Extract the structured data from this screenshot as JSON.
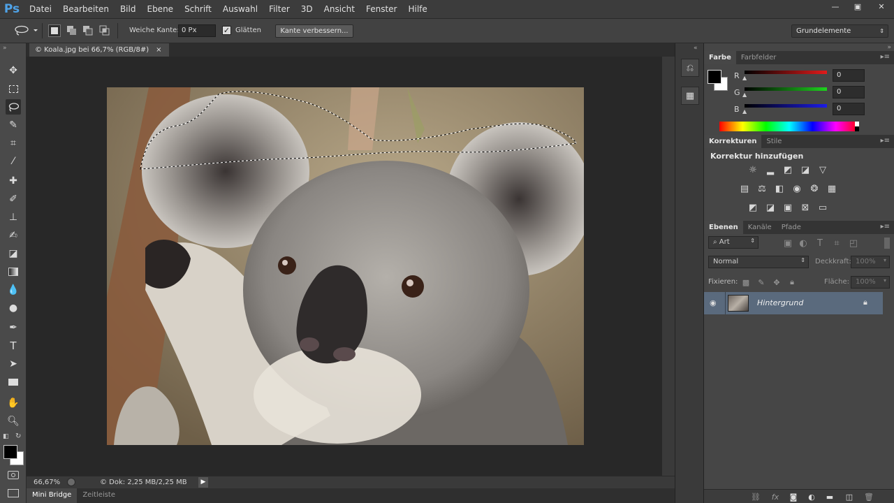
{
  "app": {
    "logo": "Ps"
  },
  "menu": [
    "Datei",
    "Bearbeiten",
    "Bild",
    "Ebene",
    "Schrift",
    "Auswahl",
    "Filter",
    "3D",
    "Ansicht",
    "Fenster",
    "Hilfe"
  ],
  "window_controls": {
    "minimize": "—",
    "restore": "▣",
    "close": "✕"
  },
  "options": {
    "feather_label": "Weiche Kante:",
    "feather_value": "0 Px",
    "antialias_label": "Glätten",
    "antialias_checked": "✓",
    "refine_edge_button": "Kante verbessern...",
    "workspace": "Grundelemente"
  },
  "document": {
    "tab_title": "© Koala.jpg bei 66,7% (RGB/8#)",
    "tab_close": "×",
    "zoom": "66,67%",
    "doc_info": "© Dok: 2,25 MB/2,25 MB"
  },
  "bottom_tabs": [
    "Mini Bridge",
    "Zeitleiste"
  ],
  "color_panel": {
    "tabs": [
      "Farbe",
      "Farbfelder"
    ],
    "channels": [
      {
        "label": "R",
        "value": "0",
        "color": "#e11b1b"
      },
      {
        "label": "G",
        "value": "0",
        "color": "#1ed31e"
      },
      {
        "label": "B",
        "value": "0",
        "color": "#1c1ce8"
      }
    ]
  },
  "adjustments_panel": {
    "tabs": [
      "Korrekturen",
      "Stile"
    ],
    "heading": "Korrektur hinzufügen"
  },
  "layers_panel": {
    "tabs": [
      "Ebenen",
      "Kanäle",
      "Pfade"
    ],
    "filter_kind": "⌕ Art",
    "blend_mode": "Normal",
    "opacity_label": "Deckkraft:",
    "opacity_value": "100%",
    "lock_label": "Fixieren:",
    "fill_label": "Fläche:",
    "fill_value": "100%",
    "layers": [
      {
        "name": "Hintergrund",
        "locked": true,
        "visible": true
      }
    ]
  }
}
